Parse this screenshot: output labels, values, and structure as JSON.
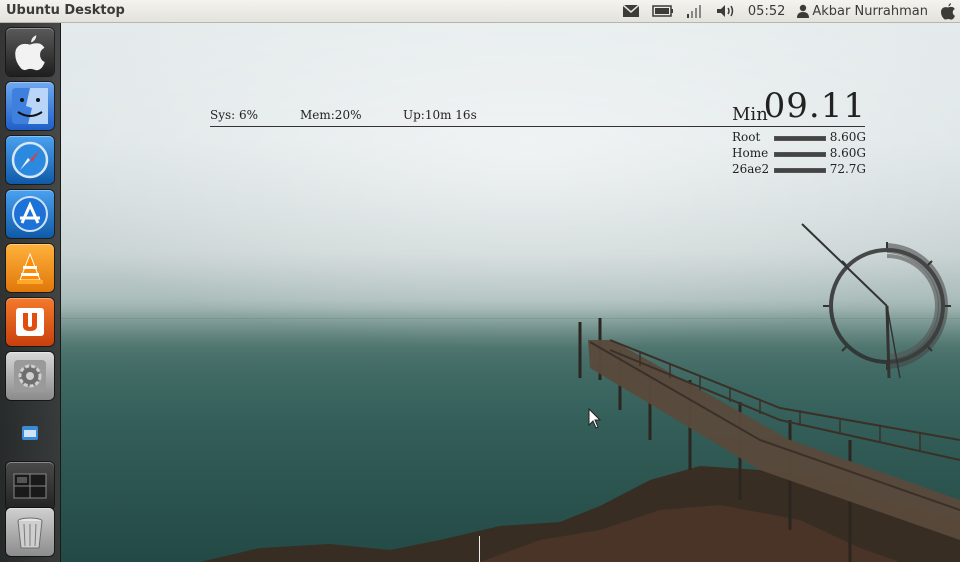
{
  "top_panel": {
    "app_title": "Ubuntu Desktop",
    "clock": "05:52",
    "user_name": "Akbar Nurrahman",
    "icons": [
      "mail-icon",
      "battery-icon",
      "network-icon",
      "volume-icon",
      "user-icon",
      "apple-icon"
    ]
  },
  "launcher": {
    "items": [
      {
        "name": "apple-app",
        "icon": "apple-icon"
      },
      {
        "name": "finder",
        "icon": "finder-icon"
      },
      {
        "name": "safari",
        "icon": "safari-icon"
      },
      {
        "name": "app-store",
        "icon": "app-store-icon"
      },
      {
        "name": "vlc",
        "icon": "vlc-icon"
      },
      {
        "name": "ubuntu-one",
        "icon": "ubuntu-one-icon"
      },
      {
        "name": "system-preferences",
        "icon": "system-preferences-icon"
      },
      {
        "name": "small-app",
        "icon": "small-app-icon"
      },
      {
        "name": "workspace-switcher",
        "icon": "workspace-icon"
      },
      {
        "name": "trash",
        "icon": "trash-icon"
      }
    ]
  },
  "conky": {
    "sys": "Sys: 6%",
    "mem": "Mem:20%",
    "up": "Up:10m 16s",
    "time_label": "Min",
    "time_value": "09.11",
    "disks": [
      {
        "name": "Root",
        "size": "8.60G",
        "fill": 0.95
      },
      {
        "name": "Home",
        "size": "8.60G",
        "fill": 0.95
      },
      {
        "name": "26ae2",
        "size": "72.7G",
        "fill": 0.95
      }
    ]
  },
  "colors": {
    "panel_bg": "#e8e6e0",
    "launcher_bg": "#2f2f2f",
    "widget_text": "#222222"
  }
}
